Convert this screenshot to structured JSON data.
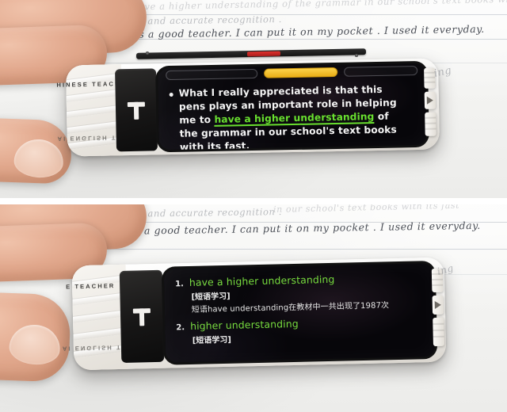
{
  "meta": {
    "composite_layout": "two stacked photo panels",
    "panel_count": 2
  },
  "device": {
    "brand_top_label": "HINESE TEACHER",
    "brand_bottom_label": "AI ENGLISH TEAC",
    "brand_top_label_2": "E TEACHER",
    "brand_bottom_label_2": "AI ENGLISH TE",
    "logo_letter": "T",
    "side_button_icon": "play-triangle-icon"
  },
  "top_panel": {
    "screen": {
      "tabs": [
        {
          "label": "",
          "state": "inactive"
        },
        {
          "label": "",
          "state": "active"
        },
        {
          "label": "",
          "state": "inactive"
        }
      ],
      "bullet_icon": "bullet-dot-icon",
      "sentence": {
        "part1": "What I really appreciated is that this pens plays an important role in helping me to ",
        "highlight": "have a higher understanding",
        "part2": " of the grammar in our school's text books with its fast."
      }
    },
    "handwriting": {
      "line1": "to have a higher understanding of the grammar in our school's text books with its fast",
      "line2": "speed and accurate recognition .",
      "line3": "It is a good teacher. I can put it on my pocket . I used it everyday."
    }
  },
  "bottom_panel": {
    "screen": {
      "results": [
        {
          "number": "1.",
          "term": "have a higher understanding",
          "tag": "[短语学习]",
          "description": "短语have understanding在教材中一共出现了1987次"
        },
        {
          "number": "2.",
          "term": "higher understanding",
          "tag": "[短语学习]",
          "description": ""
        }
      ]
    },
    "handwriting": {
      "line1": "speed and accurate recognition .",
      "line1b": "in our school's text books with its fast",
      "line2": "It is a good teacher. I can put it on my pocket . I used it everyday."
    }
  },
  "colors": {
    "highlight_green": "#69e02f",
    "result_green": "#77dc3e",
    "active_tab_yellow": "#f0bd2a",
    "screen_black": "#07060a",
    "device_white": "#f4f2ee",
    "accent_red": "#d02c28",
    "handwriting_blue": "#4257a8"
  }
}
